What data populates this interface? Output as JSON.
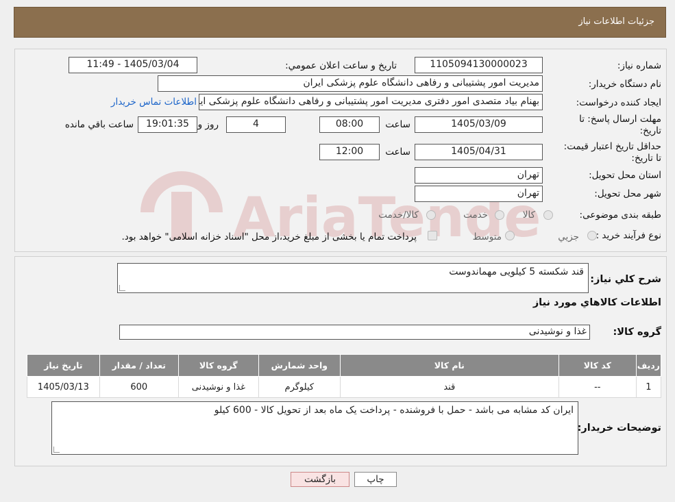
{
  "header": {
    "title": "جزئیات اطلاعات نیاز"
  },
  "labels": {
    "need_number": "شماره نیاز:",
    "announce_datetime": "تاریخ و ساعت اعلان عمومي:",
    "buyer_org": "نام دستگاه خریدار:",
    "creator": "ایجاد کننده درخواست:",
    "send_deadline": "مهلت ارسال پاسخ: تا تاریخ:",
    "time": "ساعت",
    "days_and": "روز و",
    "remaining": "ساعت باقي مانده",
    "price_validity": "حداقل تاریخ اعتبار قیمت: تا تاریخ:",
    "province": "استان محل تحویل:",
    "city": "شهر محل تحویل:",
    "category": "طبقه بندی موضوعی:",
    "process_type": "نوع فرآیند خرید :",
    "general_desc": "شرح کلي نیاز:",
    "goods_info": "اطلاعات کالاهاي مورد نیاز",
    "goods_group": "گروه کالا:",
    "buyer_notes": "توضیحات خریدار:"
  },
  "fields": {
    "need_number": "1105094130000023",
    "announce_datetime": "1405/03/04 - 11:49",
    "buyer_org": "مدیریت امور پشتیبانی و رفاهی دانشگاه علوم پزشکی ایران",
    "creator": "بهنام بیاد متصدی امور دفتری مدیریت امور پشتیبانی و رفاهی دانشگاه علوم پزشکی ایران",
    "contact_link": "اطلاعات تماس خریدار",
    "send_date": "1405/03/09",
    "send_time": "08:00",
    "days": "4",
    "remaining_time": "19:01:35",
    "validity_date": "1405/04/31",
    "validity_time": "12:00",
    "province": "تهران",
    "city": "تهران",
    "general_desc": "قند شکسته 5 کیلویی مهماندوست",
    "goods_group": "غذا و نوشیدنی",
    "buyer_notes": "ایران کد مشابه می باشد - حمل با فروشنده - پرداخت یک ماه بعد از تحویل کالا - 600 کیلو"
  },
  "category_options": [
    "کالا",
    "خدمت",
    "کالا/خدمت"
  ],
  "process_options": [
    "جزیي",
    "متوسط"
  ],
  "process_note": "پرداخت تمام یا بخشی از مبلغ خرید،از محل \"اسناد خزانه اسلامی\" خواهد بود.",
  "table": {
    "headers": [
      "ردیف",
      "کد کالا",
      "نام کالا",
      "واحد شمارش",
      "گروه کالا",
      "تعداد / مقدار",
      "تاریخ نیاز"
    ],
    "rows": [
      [
        "1",
        "--",
        "قند",
        "کیلوگرم",
        "غذا و نوشیدنی",
        "600",
        "1405/03/13"
      ]
    ]
  },
  "buttons": {
    "print": "چاپ",
    "back": "بازگشت"
  },
  "colors": {
    "header_bg": "#8b6f4e",
    "table_header_bg": "#8a8a8a",
    "link": "#1b64c9",
    "back_btn_bg": "#f9e3e3"
  },
  "watermark": {
    "text": "AriaTender.neT"
  }
}
